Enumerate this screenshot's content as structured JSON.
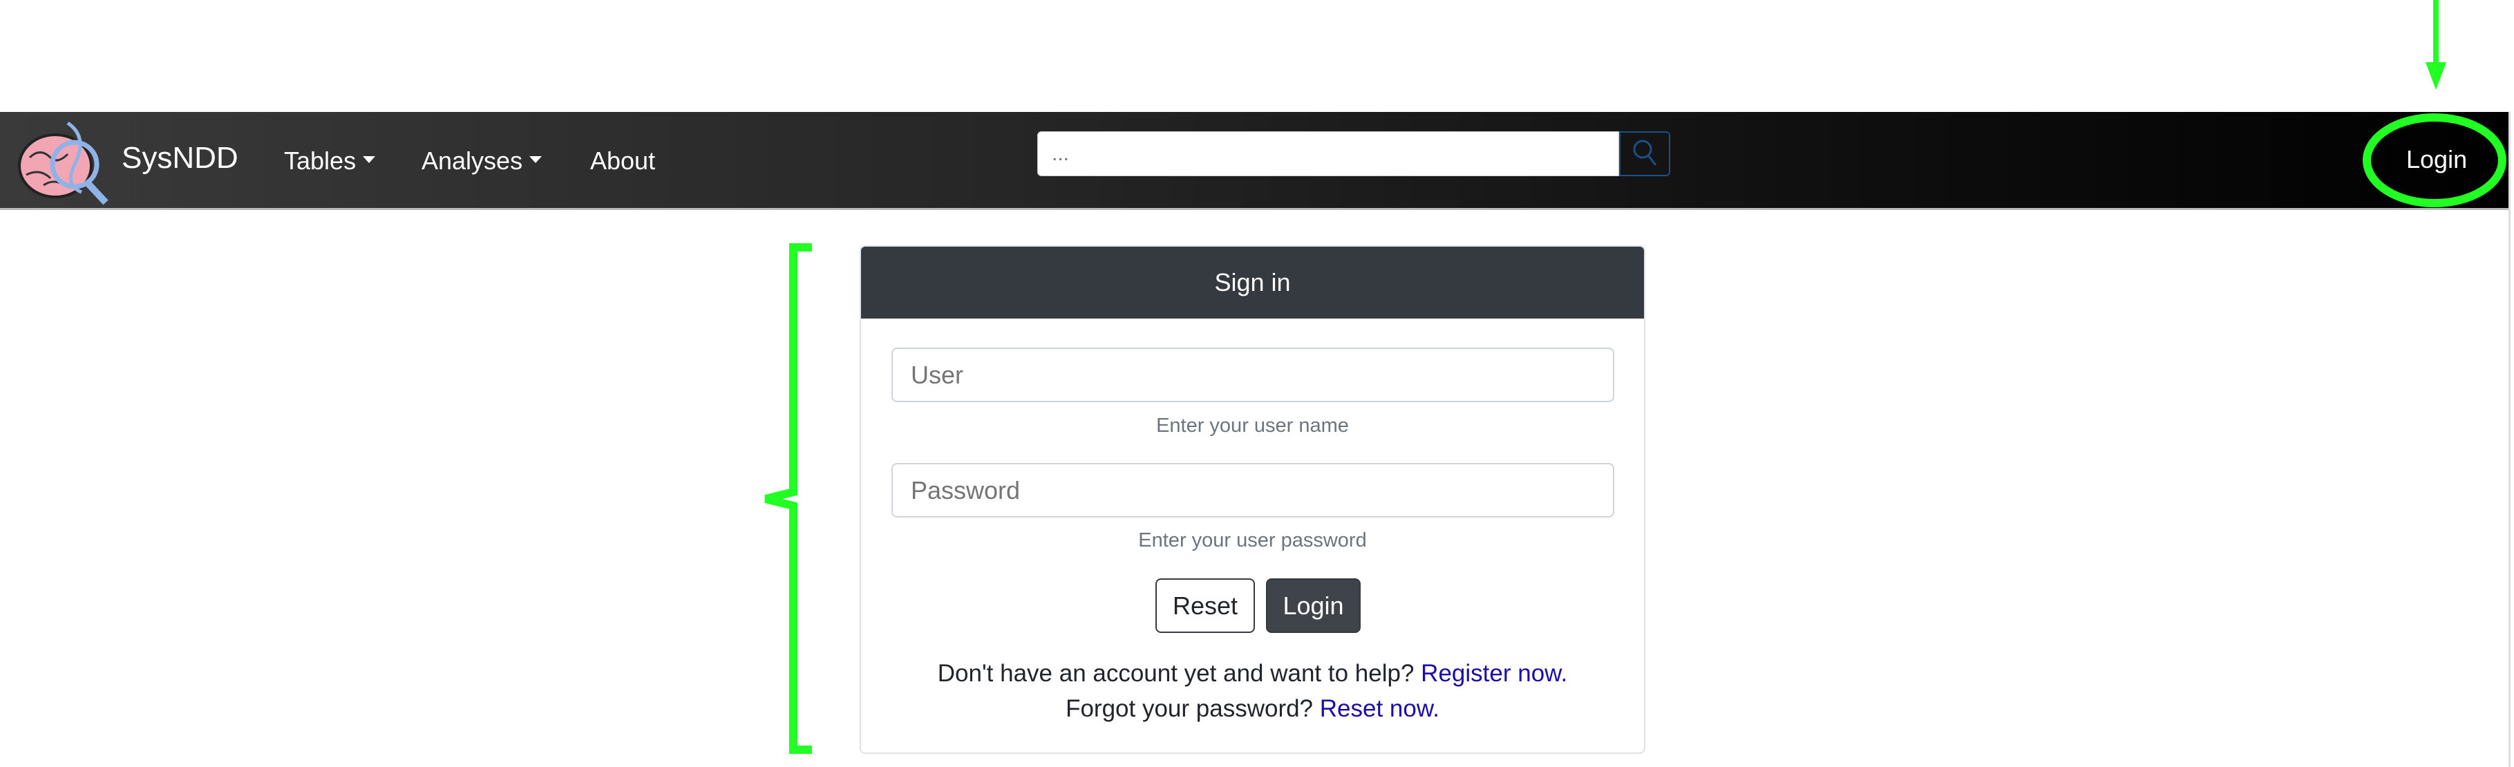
{
  "navbar": {
    "brand": "SysNDD",
    "items": [
      {
        "label": "Tables",
        "dropdown": true
      },
      {
        "label": "Analyses",
        "dropdown": true
      },
      {
        "label": "About",
        "dropdown": false
      }
    ],
    "search": {
      "placeholder": "...",
      "value": "",
      "icon": "search-icon"
    },
    "login_label": "Login"
  },
  "signin": {
    "title": "Sign in",
    "user_placeholder": "User",
    "user_help": "Enter your user name",
    "password_placeholder": "Password",
    "password_help": "Enter your user password",
    "reset_label": "Reset",
    "login_label": "Login",
    "register_prompt": "Don't have an account yet and want to help?",
    "register_link": "Register now.",
    "forgot_prompt": "Forgot your password?",
    "forgot_link": "Reset now."
  },
  "colors": {
    "annotation": "#22ff22",
    "link": "#1a0dab",
    "card_header": "#343a40"
  }
}
